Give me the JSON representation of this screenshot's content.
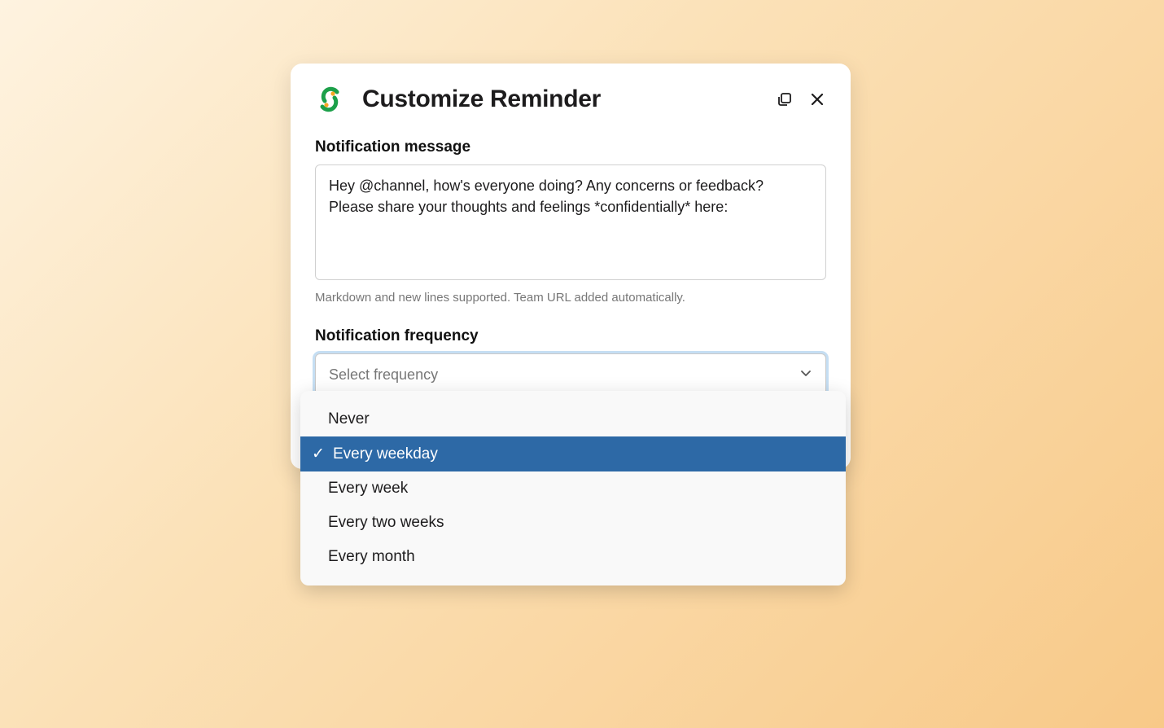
{
  "modal": {
    "title": "Customize Reminder",
    "message_section": {
      "label": "Notification message",
      "value": "Hey @channel, how's everyone doing? Any concerns or feedback? Please share your thoughts and feelings *confidentially* here:",
      "helper": "Markdown and new lines supported. Team URL added automatically."
    },
    "frequency_section": {
      "label": "Notification frequency",
      "placeholder": "Select frequency",
      "options": [
        {
          "label": "Never",
          "selected": false
        },
        {
          "label": "Every weekday",
          "selected": true
        },
        {
          "label": "Every week",
          "selected": false
        },
        {
          "label": "Every two weeks",
          "selected": false
        },
        {
          "label": "Every month",
          "selected": false
        }
      ]
    }
  }
}
